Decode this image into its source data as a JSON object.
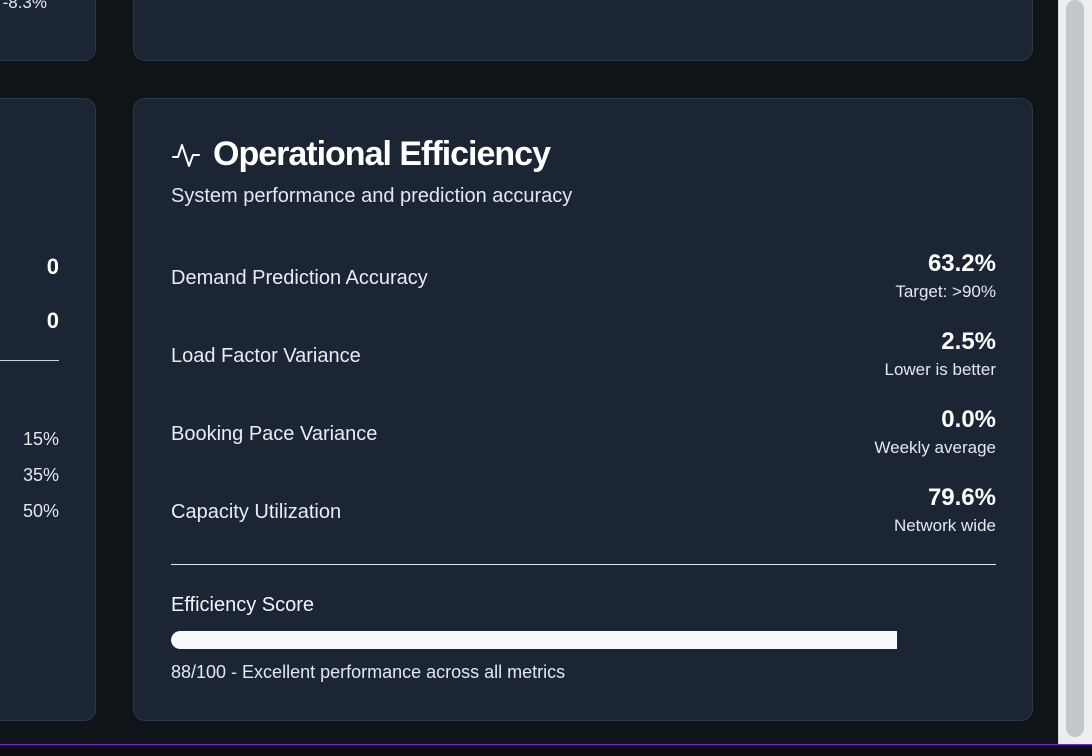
{
  "top_left_card": {
    "clipped_value": "-8.3%"
  },
  "left_card": {
    "numbers": [
      "0",
      "0"
    ],
    "percentages": [
      "15%",
      "35%",
      "50%"
    ]
  },
  "efficiency": {
    "icon": "activity-pulse-icon",
    "title": "Operational Efficiency",
    "subtitle": "System performance and prediction accuracy",
    "metrics": [
      {
        "label": "Demand Prediction Accuracy",
        "value": "63.2%",
        "note": "Target: >90%"
      },
      {
        "label": "Load Factor Variance",
        "value": "2.5%",
        "note": "Lower is better"
      },
      {
        "label": "Booking Pace Variance",
        "value": "0.0%",
        "note": "Weekly average"
      },
      {
        "label": "Capacity Utilization",
        "value": "79.6%",
        "note": "Network wide"
      }
    ],
    "score_title": "Efficiency Score",
    "score_value": 88,
    "score_caption": "88/100 - Excellent performance across all metrics"
  },
  "colors": {
    "background": "#0f1419",
    "card": "#1b2533",
    "card_border": "#2c3848",
    "progress_fill": "#f8fafc",
    "accent_line": "#6d28d9"
  }
}
